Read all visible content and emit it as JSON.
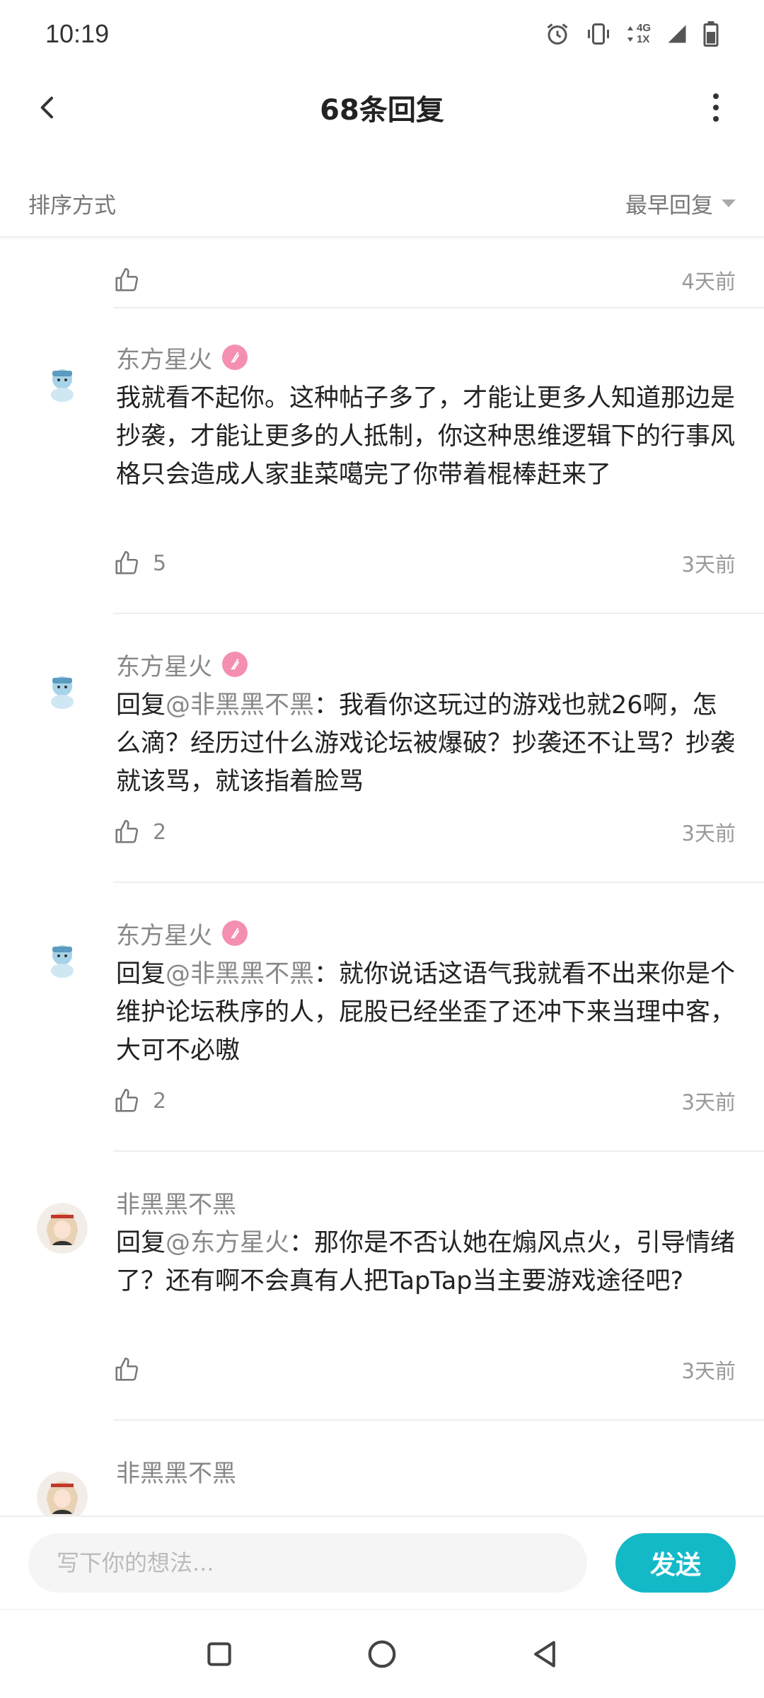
{
  "status_bar": {
    "time": "10:19",
    "network_label_top": "4G",
    "network_label_bottom": "1X"
  },
  "header": {
    "title": "68条回复"
  },
  "sort": {
    "label": "排序方式",
    "value": "最早回复"
  },
  "partial_top": {
    "like_count": "",
    "time": "4天前"
  },
  "comments": [
    {
      "author": "东方星火",
      "prefix": "",
      "mention": "",
      "text": "我就看不起你。这种帖子多了，才能让更多人知道那边是抄袭，才能让更多的人抵制，你这种思维逻辑下的行事风格只会造成人家韭菜噶完了你带着棍棒赶来了",
      "like_count": "5",
      "time": "3天前"
    },
    {
      "author": "东方星火",
      "prefix": "回复",
      "mention": "@非黑黑不黑",
      "text": "：我看你这玩过的游戏也就26啊，怎么滴？经历过什么游戏论坛被爆破？抄袭还不让骂？抄袭就该骂，就该指着脸骂",
      "like_count": "2",
      "time": "3天前"
    },
    {
      "author": "东方星火",
      "prefix": "回复",
      "mention": "@非黑黑不黑",
      "text": "：就你说话这语气我就看不出来你是个维护论坛秩序的人，屁股已经坐歪了还冲下来当理中客，大可不必嗷",
      "like_count": "2",
      "time": "3天前"
    },
    {
      "author": "非黑黑不黑",
      "prefix": "回复",
      "mention": "@东方星火",
      "text": "：那你是不否认她在煽风点火，引导情绪了？还有啊不会真有人把TapTap当主要游戏途径吧?",
      "like_count": "",
      "time": "3天前"
    },
    {
      "author": "非黑黑不黑",
      "prefix": "",
      "mention": "",
      "text": "",
      "like_count": "",
      "time": ""
    }
  ],
  "input_bar": {
    "placeholder": "写下你的想法...",
    "send_label": "发送"
  },
  "colors": {
    "accent": "#14b9c8",
    "badge": "#f48fb1",
    "secondary_text": "#888888"
  }
}
